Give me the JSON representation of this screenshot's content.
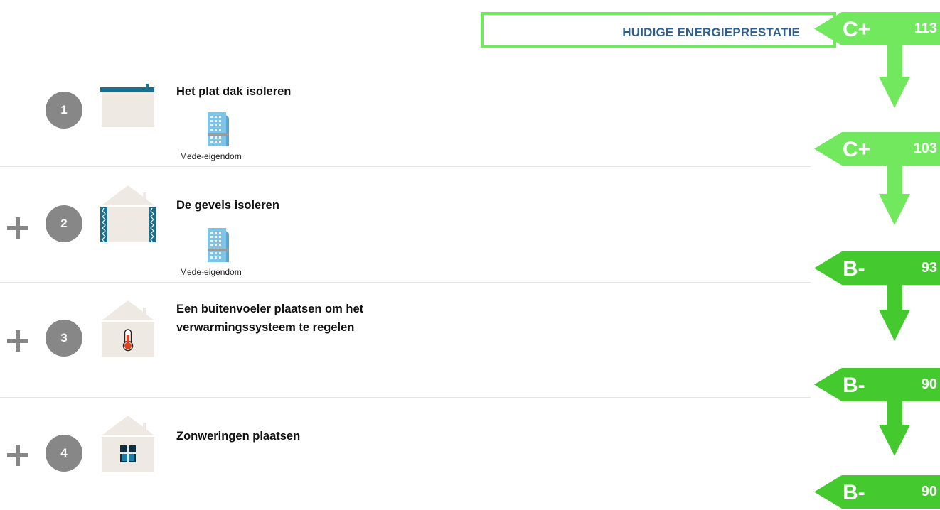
{
  "banner": {
    "title": "HUIDIGE ENERGIEPRESTATIE"
  },
  "labels": [
    {
      "grade": "C+",
      "score": "113",
      "color": "#72e85f"
    },
    {
      "grade": "C+",
      "score": "103",
      "color": "#72e85f"
    },
    {
      "grade": "B-",
      "score": "93",
      "color": "#44c92e"
    },
    {
      "grade": "B-",
      "score": "90",
      "color": "#44c92e"
    },
    {
      "grade": "B-",
      "score": "90",
      "color": "#44c92e"
    }
  ],
  "steps": [
    {
      "number": "1",
      "title": "Het plat dak isoleren",
      "badge": "Mede-eigendom",
      "icon": "flat-roof-icon"
    },
    {
      "number": "2",
      "title": "De gevels isoleren",
      "badge": "Mede-eigendom",
      "icon": "facade-insulation-icon"
    },
    {
      "number": "3",
      "title": "Een buitenvoeler plaatsen om het verwarmingssysteem te regelen",
      "icon": "thermometer-house-icon"
    },
    {
      "number": "4",
      "title": "Zonweringen plaatsen",
      "icon": "window-shade-house-icon"
    }
  ],
  "colors": {
    "light_green": "#72e85f",
    "dark_green": "#44c92e",
    "step_gray": "#878787",
    "banner_text": "#2e5f8e",
    "house_beige": "#efe9e3",
    "accent_teal": "#1a6f8e"
  }
}
